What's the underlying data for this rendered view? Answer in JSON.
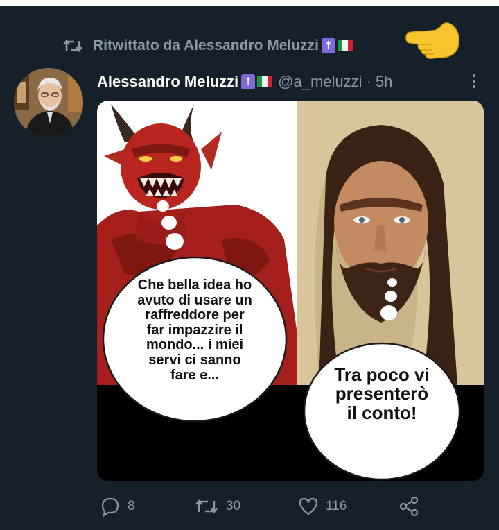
{
  "retweet": {
    "text": "Ritwittato da Alessandro Meluzzi",
    "icon": "retweet-icon"
  },
  "tweet": {
    "author_name": "Alessandro Meluzzi",
    "handle": "@a_meluzzi",
    "separator": "·",
    "time": "5h",
    "devil_bubble": [
      "Che bella idea ho",
      "avuto di usare un",
      "raffreddore per",
      "far impazzire il",
      "mondo... i miei",
      "servi ci sanno",
      "fare e..."
    ],
    "jesus_bubble": [
      "Tra poco vi",
      "presenterò",
      "il conto!"
    ]
  },
  "actions": {
    "replies": "8",
    "retweets": "30",
    "likes": "116"
  },
  "colors": {
    "background": "#15202b",
    "secondary_text": "#8b98a5",
    "badge_purple": "#7e6bd8"
  }
}
